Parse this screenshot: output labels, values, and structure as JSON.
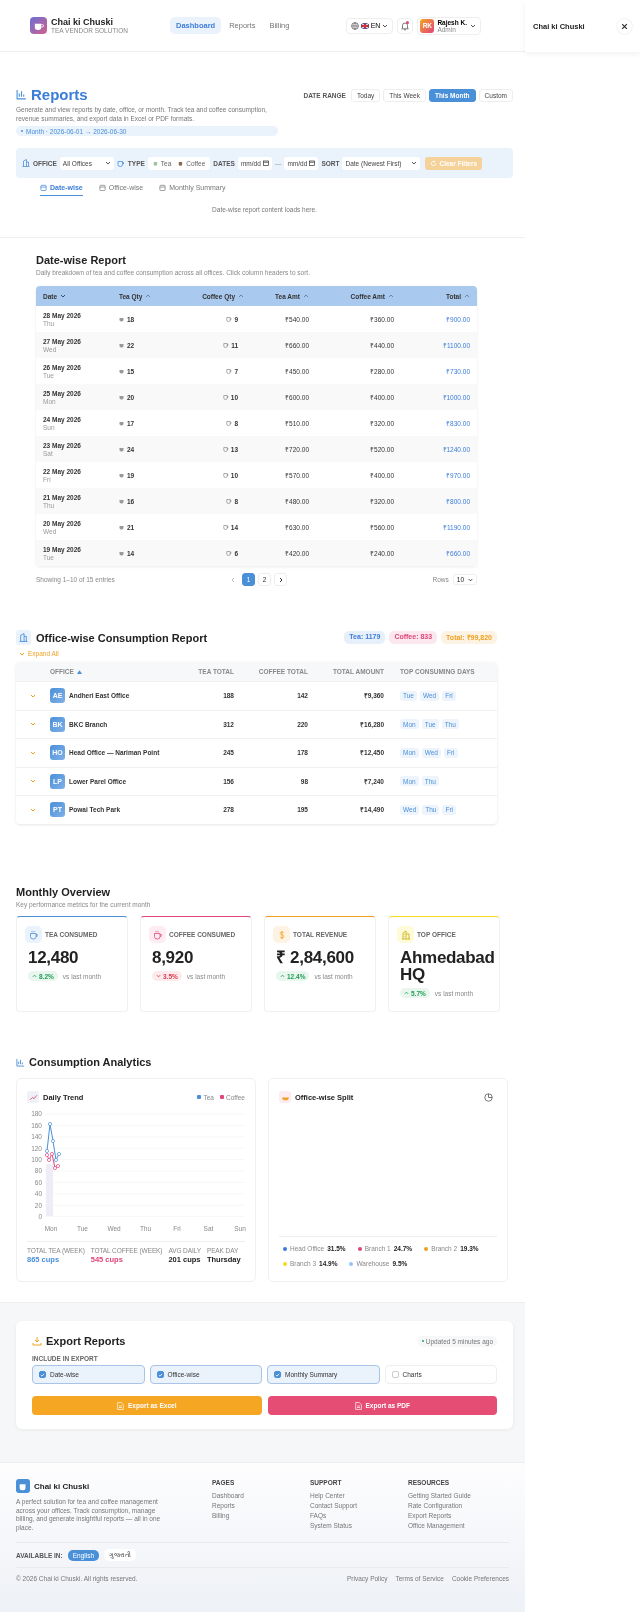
{
  "app": {
    "brand": "Chai ki Chuski",
    "tagline": "TEA VENDOR SOLUTION"
  },
  "nav": [
    {
      "label": "Dashboard",
      "selected": true
    },
    {
      "label": "Reports",
      "selected": false
    },
    {
      "label": "Billing",
      "selected": false
    }
  ],
  "language_menu": {
    "label": "EN"
  },
  "notifications": {
    "unread": true
  },
  "user": {
    "initials": "RK",
    "name": "Rajesh K.",
    "role": "Admin"
  },
  "side_panel": {
    "title": "Chai ki Chuski"
  },
  "reports": {
    "title": "Reports",
    "description": "Generate and view reports by date, office, or month. Track tea and coffee consumption, revenue summaries, and export data in Excel or PDF formats.",
    "period": "Month · 2026-06-01 → 2026-06-30",
    "date_range_label": "DATE RANGE",
    "date_ranges": [
      {
        "label": "Today",
        "selected": false
      },
      {
        "label": "This Week",
        "selected": false
      },
      {
        "label": "This Month",
        "selected": true
      },
      {
        "label": "Custom",
        "selected": false
      }
    ]
  },
  "filters": {
    "office_label": "OFFICE",
    "office_value": "All Offices",
    "type_label": "TYPE",
    "types": [
      {
        "label": "Tea",
        "selected": false
      },
      {
        "label": "Coffee",
        "selected": false
      }
    ],
    "dates_label": "DATES",
    "date_from": "mm/dd",
    "date_separator": "—",
    "date_to": "mm/dd",
    "sort_label": "SORT",
    "sort_value": "Date (Newest First)",
    "clear": "Clear Filters",
    "clear_disabled": true
  },
  "report_tabs": [
    {
      "label": "Date-wise",
      "selected": true
    },
    {
      "label": "Office-wise",
      "selected": false
    },
    {
      "label": "Monthly Summary",
      "selected": false
    }
  ],
  "tab_content_note": "Date-wise report content loads here.",
  "date_report": {
    "title": "Date-wise Report",
    "subtitle": "Daily breakdown of tea and coffee consumption across all offices. Click column headers to sort.",
    "columns": [
      {
        "label": "Date",
        "sorted": true
      },
      {
        "label": "Tea Qty",
        "sorted": false
      },
      {
        "label": "Coffee Qty",
        "sorted": false
      },
      {
        "label": "Tea Amt",
        "sorted": false
      },
      {
        "label": "Coffee Amt",
        "sorted": false
      },
      {
        "label": "Total",
        "sorted": false
      }
    ],
    "rows": [
      {
        "date": "28 May 2026",
        "day": "Thu",
        "tea": "18",
        "coffee": "9",
        "tea_amt": "₹540.00",
        "coffee_amt": "₹360.00",
        "total": "₹900.00"
      },
      {
        "date": "27 May 2026",
        "day": "Wed",
        "tea": "22",
        "coffee": "11",
        "tea_amt": "₹660.00",
        "coffee_amt": "₹440.00",
        "total": "₹1100.00"
      },
      {
        "date": "26 May 2026",
        "day": "Tue",
        "tea": "15",
        "coffee": "7",
        "tea_amt": "₹450.00",
        "coffee_amt": "₹280.00",
        "total": "₹730.00"
      },
      {
        "date": "25 May 2026",
        "day": "Mon",
        "tea": "20",
        "coffee": "10",
        "tea_amt": "₹600.00",
        "coffee_amt": "₹400.00",
        "total": "₹1000.00"
      },
      {
        "date": "24 May 2026",
        "day": "Sun",
        "tea": "17",
        "coffee": "8",
        "tea_amt": "₹510.00",
        "coffee_amt": "₹320.00",
        "total": "₹830.00"
      },
      {
        "date": "23 May 2026",
        "day": "Sat",
        "tea": "24",
        "coffee": "13",
        "tea_amt": "₹720.00",
        "coffee_amt": "₹520.00",
        "total": "₹1240.00"
      },
      {
        "date": "22 May 2026",
        "day": "Fri",
        "tea": "19",
        "coffee": "10",
        "tea_amt": "₹570.00",
        "coffee_amt": "₹400.00",
        "total": "₹970.00"
      },
      {
        "date": "21 May 2026",
        "day": "Thu",
        "tea": "16",
        "coffee": "8",
        "tea_amt": "₹480.00",
        "coffee_amt": "₹320.00",
        "total": "₹800.00"
      },
      {
        "date": "20 May 2026",
        "day": "Wed",
        "tea": "21",
        "coffee": "14",
        "tea_amt": "₹630.00",
        "coffee_amt": "₹560.00",
        "total": "₹1190.00"
      },
      {
        "date": "19 May 2026",
        "day": "Tue",
        "tea": "14",
        "coffee": "6",
        "tea_amt": "₹420.00",
        "coffee_amt": "₹240.00",
        "total": "₹660.00"
      }
    ],
    "showing": "Showing 1–10 of 15 entries",
    "pages": [
      {
        "label": "1",
        "selected": true
      },
      {
        "label": "2",
        "selected": false
      }
    ],
    "rows_label": "Rows",
    "rows_value": "10"
  },
  "office_report": {
    "title": "Office-wise Consumption Report",
    "summary": [
      {
        "label": "Tea: 1179",
        "color": "#3b7dd8"
      },
      {
        "label": "Coffee: 833",
        "color": "#e0457b"
      },
      {
        "label": "Total: ₹99,820",
        "color": "#f0a020"
      }
    ],
    "expand_all": "Expand All",
    "columns": [
      {
        "label": "OFFICE",
        "sorted": true
      },
      {
        "label": "TEA TOTAL",
        "sorted": false
      },
      {
        "label": "COFFEE TOTAL",
        "sorted": false
      },
      {
        "label": "TOTAL AMOUNT",
        "sorted": false
      },
      {
        "label": "TOP CONSUMING DAYS",
        "sorted": false
      }
    ],
    "rows": [
      {
        "initials": "AE",
        "office": "Andheri East Office",
        "tea": "188",
        "coffee": "142",
        "amount": "₹9,360",
        "days": [
          "Tue",
          "Wed",
          "Fri"
        ]
      },
      {
        "initials": "BK",
        "office": "BKC Branch",
        "tea": "312",
        "coffee": "220",
        "amount": "₹16,280",
        "days": [
          "Mon",
          "Tue",
          "Thu"
        ]
      },
      {
        "initials": "HO",
        "office": "Head Office — Nariman Point",
        "tea": "245",
        "coffee": "178",
        "amount": "₹12,450",
        "days": [
          "Mon",
          "Wed",
          "Fri"
        ]
      },
      {
        "initials": "LP",
        "office": "Lower Parel Office",
        "tea": "156",
        "coffee": "98",
        "amount": "₹7,240",
        "days": [
          "Mon",
          "Thu"
        ]
      },
      {
        "initials": "PT",
        "office": "Powai Tech Park",
        "tea": "278",
        "coffee": "195",
        "amount": "₹14,490",
        "days": [
          "Wed",
          "Thu",
          "Fri"
        ]
      }
    ]
  },
  "monthly": {
    "title": "Monthly Overview",
    "subtitle": "Key performance metrics for the current month",
    "cards": [
      {
        "kind": "tea",
        "label": "TEA CONSUMED",
        "value": "12,480",
        "change": "8.2%",
        "rising": true,
        "note": "vs last month",
        "color": "#4a90d9"
      },
      {
        "kind": "coffee",
        "label": "COFFEE CONSUMED",
        "value": "8,920",
        "change": "3.5%",
        "rising": false,
        "note": "vs last month",
        "color": "#e0457b"
      },
      {
        "kind": "revenue",
        "label": "TOTAL REVENUE",
        "value": "₹ 2,84,600",
        "change": "12.4%",
        "rising": true,
        "note": "vs last month",
        "color": "#f0a020"
      },
      {
        "kind": "office",
        "label": "TOP OFFICE",
        "value": "Ahmedabad HQ",
        "change": "5.7%",
        "rising": true,
        "note": "vs last month",
        "color": "#f5dc1a"
      }
    ]
  },
  "analytics": {
    "title": "Consumption Analytics",
    "trend": {
      "title": "Daily Trend",
      "legend": [
        {
          "label": "Tea",
          "color": "#4a90d9"
        },
        {
          "label": "Coffee",
          "color": "#e0457b"
        }
      ],
      "y_ticks": [
        "180",
        "160",
        "140",
        "120",
        "100",
        "80",
        "60",
        "40",
        "20",
        "0"
      ],
      "x_labels": [
        "Mon",
        "Tue",
        "Wed",
        "Thu",
        "Fri",
        "Sat",
        "Sun"
      ],
      "stats": [
        {
          "label": "TOTAL TEA (WEEK)",
          "value": "865 cups",
          "color": "#4a90d9"
        },
        {
          "label": "TOTAL COFFEE (WEEK)",
          "value": "545 cups",
          "color": "#e0457b"
        },
        {
          "label": "AVG DAILY",
          "value": "201 cups",
          "color": "#222222"
        },
        {
          "label": "PEAK DAY",
          "value": "Thursday",
          "color": "#222222"
        }
      ]
    },
    "split": {
      "title": "Office-wise Split",
      "legend": [
        {
          "label": "Head Office",
          "value": "31.5%",
          "color": "#3b7dd8"
        },
        {
          "label": "Branch 1",
          "value": "24.7%",
          "color": "#e0457b"
        },
        {
          "label": "Branch 2",
          "value": "19.3%",
          "color": "#f0a020"
        },
        {
          "label": "Branch 3",
          "value": "14.9%",
          "color": "#f5dc1a"
        },
        {
          "label": "Warehouse",
          "value": "9.5%",
          "color": "#93c5fd"
        }
      ]
    }
  },
  "export": {
    "title": "Export Reports",
    "status": "Updated 5 minutes ago",
    "include_label": "INCLUDE IN EXPORT",
    "options": [
      {
        "label": "Date-wise",
        "checked": true
      },
      {
        "label": "Office-wise",
        "checked": true
      },
      {
        "label": "Monthly Summary",
        "checked": true
      },
      {
        "label": "Charts",
        "checked": false
      }
    ],
    "buttons": [
      {
        "label": "Export as Excel",
        "kind": "excel"
      },
      {
        "label": "Export as PDF",
        "kind": "pdf"
      }
    ]
  },
  "footer": {
    "brand": "Chai ki Chuski",
    "description": "A perfect solution for tea and coffee management across your offices. Track consumption, manage billing, and generate insightful reports — all in one place.",
    "columns": [
      {
        "title": "PAGES",
        "links": [
          "Dashboard",
          "Reports",
          "Billing"
        ]
      },
      {
        "title": "SUPPORT",
        "links": [
          "Help Center",
          "Contact Support",
          "FAQs",
          "System Status"
        ]
      },
      {
        "title": "RESOURCES",
        "links": [
          "Getting Started Guide",
          "Rate Configuration",
          "Export Reports",
          "Office Management"
        ]
      }
    ],
    "available_label": "AVAILABLE IN:",
    "languages": [
      {
        "label": "English",
        "selected": true
      },
      {
        "label": "ગુજરાતી",
        "selected": false
      }
    ],
    "copyright": "© 2026 Chai ki Chuski. All rights reserved.",
    "legal": [
      "Privacy Policy",
      "Terms of Service",
      "Cookie Preferences"
    ]
  }
}
